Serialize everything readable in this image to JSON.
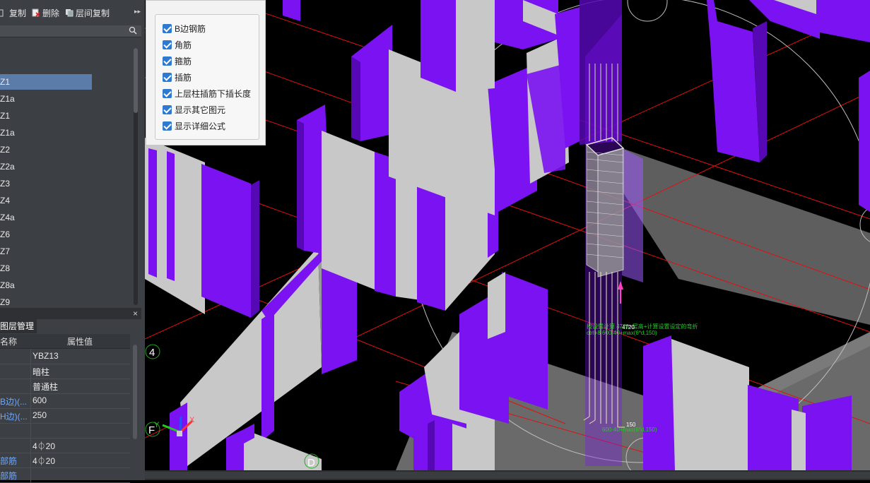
{
  "toolbar": {
    "copy_label": "复制",
    "delete_label": "删除",
    "floor_copy_label": "层间复制",
    "more": "▸▸"
  },
  "list": {
    "items": [
      "Z1",
      "Z1a",
      "Z1",
      "Z1a",
      "Z2",
      "Z2a",
      "Z3",
      "Z4",
      "Z4a",
      "Z6",
      "Z7",
      "Z8",
      "Z8a",
      "Z9"
    ],
    "selected_index": 0
  },
  "bottom_panel": {
    "close": "×",
    "tab_label": "图层管理",
    "col_name": "名称",
    "col_value": "属性值",
    "rows": [
      {
        "key": "",
        "value": "YBZ13",
        "link": false
      },
      {
        "key": "",
        "value": "暗柱",
        "link": false
      },
      {
        "key": "",
        "value": "普通柱",
        "link": false
      },
      {
        "key": "B边)(...",
        "value": "600",
        "link": true
      },
      {
        "key": "H边)(...",
        "value": "250",
        "link": true
      },
      {
        "key": "",
        "value": "",
        "link": false
      },
      {
        "key": "",
        "value": "4⏀20",
        "link": false
      },
      {
        "key": "部筋",
        "value": "4⏀20",
        "link": true
      },
      {
        "key": "部筋",
        "value": "",
        "link": true
      }
    ]
  },
  "popup": {
    "options": [
      {
        "label": "B边钢筋",
        "checked": true
      },
      {
        "label": "角筋",
        "checked": true
      },
      {
        "label": "箍筋",
        "checked": true
      },
      {
        "label": "插筋",
        "checked": true
      },
      {
        "label": "上层柱插筋下插长度",
        "checked": true
      },
      {
        "label": "显示其它图元",
        "checked": true
      },
      {
        "label": "显示详细公式",
        "checked": true
      }
    ]
  },
  "viewport": {
    "axis_labels": [
      "4",
      "F",
      "D"
    ],
    "annotation_1": "4720",
    "annotation_2": "150",
    "formula_1": "按设置计算 4720=层高+计算设置设定的弯折",
    "formula_2": "ctrl+8 600-40+max(6*d,150)",
    "formula_3": "600-40+max(6*d,150)"
  },
  "colors": {
    "wall_purple": "#7b12f2",
    "wall_purple_dark": "#5608b4",
    "wall_grey": "#c8c8c8",
    "selected_row": "#5b7ba8",
    "checkbox": "#2e7ad1",
    "grid_red": "#e01010"
  }
}
